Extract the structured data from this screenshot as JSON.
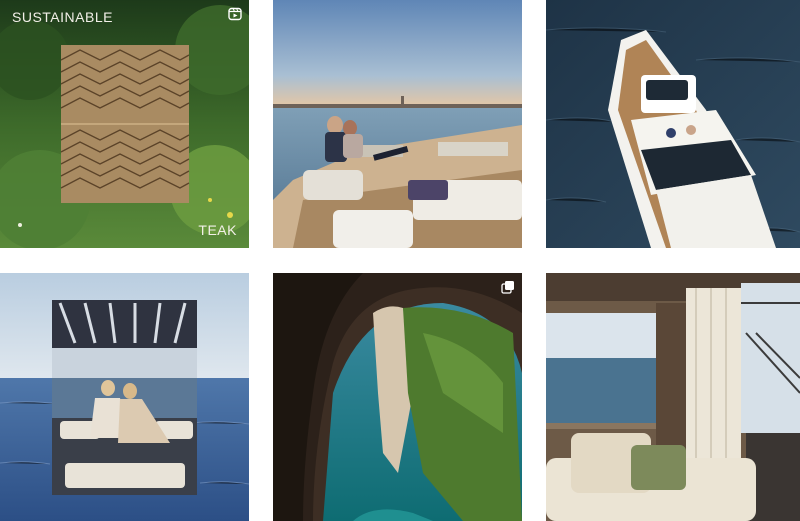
{
  "grid": {
    "posts": [
      {
        "id": "post-1",
        "caption_top": "SUSTAINABLE",
        "caption_bottom": "TEAK",
        "badge": "reel-icon",
        "subject": "teak-wood-panel-in-forest"
      },
      {
        "id": "post-2",
        "badge": "",
        "subject": "couple-on-yacht-deck-at-sunset"
      },
      {
        "id": "post-3",
        "badge": "",
        "subject": "aerial-view-of-yacht"
      },
      {
        "id": "post-4",
        "badge": "",
        "subject": "women-on-yacht-lounge-collage"
      },
      {
        "id": "post-5",
        "badge": "carousel-icon",
        "subject": "sea-cave-coastline"
      },
      {
        "id": "post-6",
        "badge": "",
        "subject": "yacht-interior-lounge"
      }
    ]
  },
  "colors": {
    "background": "#ffffff",
    "overlay_text": "#f2efe8",
    "badge": "#ffffff"
  }
}
